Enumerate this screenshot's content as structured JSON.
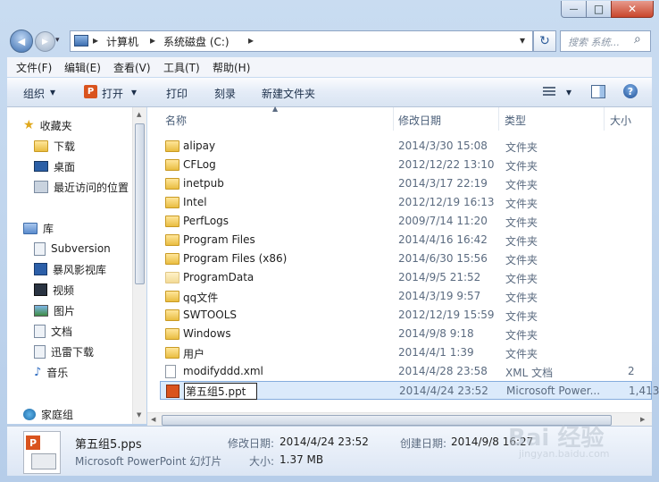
{
  "window": {
    "min_glyph": "—",
    "max_glyph": "□",
    "close_glyph": "✕"
  },
  "address": {
    "back_glyph": "◀",
    "forward_glyph": "▶",
    "crumb_sep": "▸",
    "crumbs": [
      "计算机",
      "系统磁盘 (C:)"
    ],
    "dropdown_glyph": "▾",
    "refresh_glyph": "↻",
    "search_placeholder": "搜索 系统...",
    "search_glyph": "⌕"
  },
  "menu": [
    "文件(F)",
    "编辑(E)",
    "查看(V)",
    "工具(T)",
    "帮助(H)"
  ],
  "toolbar": {
    "organize": "组织",
    "open": "打开",
    "print": "打印",
    "burn": "刻录",
    "new_folder": "新建文件夹",
    "dropdown_glyph": "▾",
    "help_glyph": "?"
  },
  "nav": {
    "favorites": "收藏夹",
    "fav_items": [
      "下载",
      "桌面",
      "最近访问的位置"
    ],
    "library": "库",
    "lib_items": [
      "Subversion",
      "暴风影视库",
      "视频",
      "图片",
      "文档",
      "迅雷下载",
      "音乐"
    ],
    "homegroup": "家庭组"
  },
  "columns": {
    "name": "名称",
    "date": "修改日期",
    "type": "类型",
    "size": "大小"
  },
  "files": [
    {
      "name": "alipay",
      "date": "2014/3/30 15:08",
      "type": "文件夹",
      "size": ""
    },
    {
      "name": "CFLog",
      "date": "2012/12/22 13:10",
      "type": "文件夹",
      "size": ""
    },
    {
      "name": "inetpub",
      "date": "2014/3/17 22:19",
      "type": "文件夹",
      "size": ""
    },
    {
      "name": "Intel",
      "date": "2012/12/19 16:13",
      "type": "文件夹",
      "size": ""
    },
    {
      "name": "PerfLogs",
      "date": "2009/7/14 11:20",
      "type": "文件夹",
      "size": ""
    },
    {
      "name": "Program Files",
      "date": "2014/4/16 16:42",
      "type": "文件夹",
      "size": ""
    },
    {
      "name": "Program Files (x86)",
      "date": "2014/6/30 15:56",
      "type": "文件夹",
      "size": ""
    },
    {
      "name": "ProgramData",
      "date": "2014/9/5 21:52",
      "type": "文件夹",
      "size": ""
    },
    {
      "name": "qq文件",
      "date": "2014/3/19 9:57",
      "type": "文件夹",
      "size": ""
    },
    {
      "name": "SWTOOLS",
      "date": "2012/12/19 15:59",
      "type": "文件夹",
      "size": ""
    },
    {
      "name": "Windows",
      "date": "2014/9/8 9:18",
      "type": "文件夹",
      "size": ""
    },
    {
      "name": "用户",
      "date": "2014/4/1 1:39",
      "type": "文件夹",
      "size": ""
    },
    {
      "name": "modifyddd.xml",
      "date": "2014/4/28 23:58",
      "type": "XML 文档",
      "size": "2"
    },
    {
      "name": "第五组5.ppt",
      "date": "2014/4/24 23:52",
      "type": "Microsoft Power...",
      "size": "1,413"
    }
  ],
  "details": {
    "filename": "第五组5.pps",
    "filetype": "Microsoft PowerPoint 幻灯片",
    "modified_label": "修改日期:",
    "modified": "2014/4/24 23:52",
    "size_label": "大小:",
    "size": "1.37 MB",
    "created_label": "创建日期:",
    "created": "2014/9/8 16:27"
  },
  "watermark": {
    "logo": "Bai 经验",
    "url": "jingyan.baidu.com"
  }
}
